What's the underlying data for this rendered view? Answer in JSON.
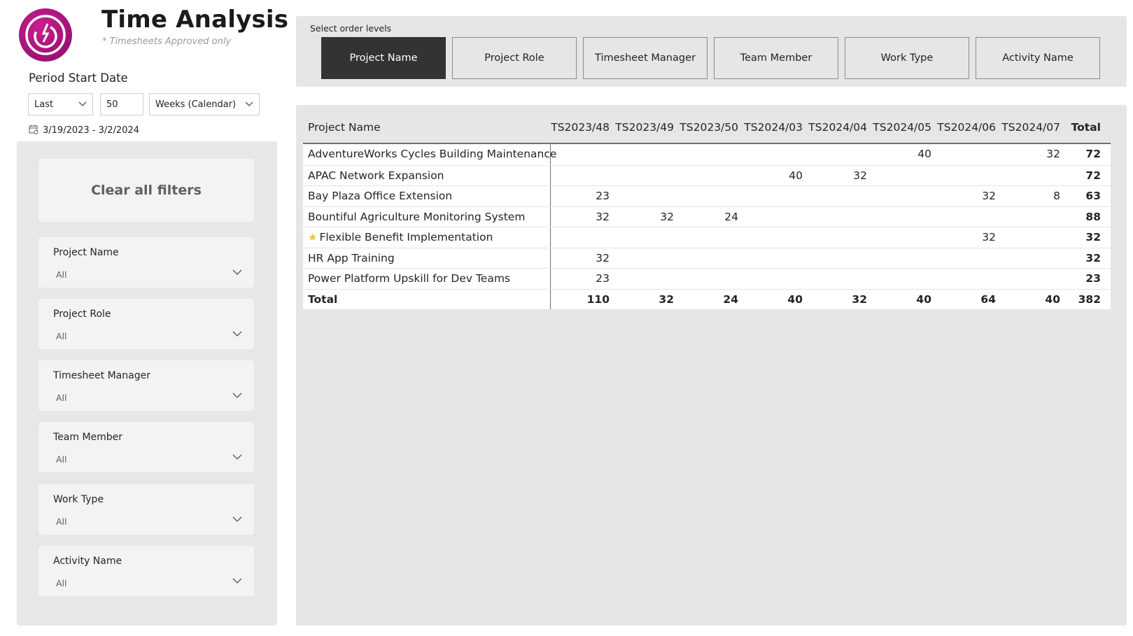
{
  "header": {
    "title": "Time Analysis",
    "subtitle": "* Timesheets Approved only",
    "logo_icon": "power-icon",
    "brand_color": "#a3137a"
  },
  "period": {
    "label": "Period Start Date",
    "mode": "Last",
    "count": "50",
    "unit": "Weeks (Calendar)",
    "range": "3/19/2023 - 3/2/2024"
  },
  "filters": {
    "clear_label": "Clear all filters",
    "items": [
      {
        "label": "Project Name",
        "value": "All"
      },
      {
        "label": "Project Role",
        "value": "All"
      },
      {
        "label": "Timesheet Manager",
        "value": "All"
      },
      {
        "label": "Team Member",
        "value": "All"
      },
      {
        "label": "Work Type",
        "value": "All"
      },
      {
        "label": "Activity Name",
        "value": "All"
      }
    ]
  },
  "order_levels": {
    "label": "Select order levels",
    "buttons": [
      {
        "label": "Project Name",
        "active": true
      },
      {
        "label": "Project Role",
        "active": false
      },
      {
        "label": "Timesheet Manager",
        "active": false
      },
      {
        "label": "Team Member",
        "active": false
      },
      {
        "label": "Work Type",
        "active": false
      },
      {
        "label": "Activity Name",
        "active": false
      }
    ]
  },
  "matrix": {
    "row_header": "Project Name",
    "columns": [
      "TS2023/48",
      "TS2023/49",
      "TS2023/50",
      "TS2024/03",
      "TS2024/04",
      "TS2024/05",
      "TS2024/06",
      "TS2024/07"
    ],
    "total_header": "Total",
    "rows": [
      {
        "name": "AdventureWorks Cycles Building Maintenance",
        "star": false,
        "values": [
          "",
          "",
          "",
          "",
          "",
          "40",
          "",
          "32"
        ],
        "total": "72"
      },
      {
        "name": "APAC Network Expansion",
        "star": false,
        "values": [
          "",
          "",
          "",
          "40",
          "32",
          "",
          "",
          ""
        ],
        "total": "72"
      },
      {
        "name": "Bay Plaza Office Extension",
        "star": false,
        "values": [
          "23",
          "",
          "",
          "",
          "",
          "",
          "32",
          "8"
        ],
        "total": "63"
      },
      {
        "name": "Bountiful Agriculture Monitoring System",
        "star": false,
        "values": [
          "32",
          "32",
          "24",
          "",
          "",
          "",
          "",
          ""
        ],
        "total": "88"
      },
      {
        "name": "Flexible Benefit Implementation",
        "star": true,
        "values": [
          "",
          "",
          "",
          "",
          "",
          "",
          "32",
          ""
        ],
        "total": "32"
      },
      {
        "name": "HR App Training",
        "star": false,
        "values": [
          "32",
          "",
          "",
          "",
          "",
          "",
          "",
          ""
        ],
        "total": "32"
      },
      {
        "name": "Power Platform Upskill for Dev Teams",
        "star": false,
        "values": [
          "23",
          "",
          "",
          "",
          "",
          "",
          "",
          ""
        ],
        "total": "23"
      }
    ],
    "total_row": {
      "label": "Total",
      "values": [
        "110",
        "32",
        "24",
        "40",
        "32",
        "40",
        "64",
        "40"
      ],
      "total": "382"
    }
  }
}
